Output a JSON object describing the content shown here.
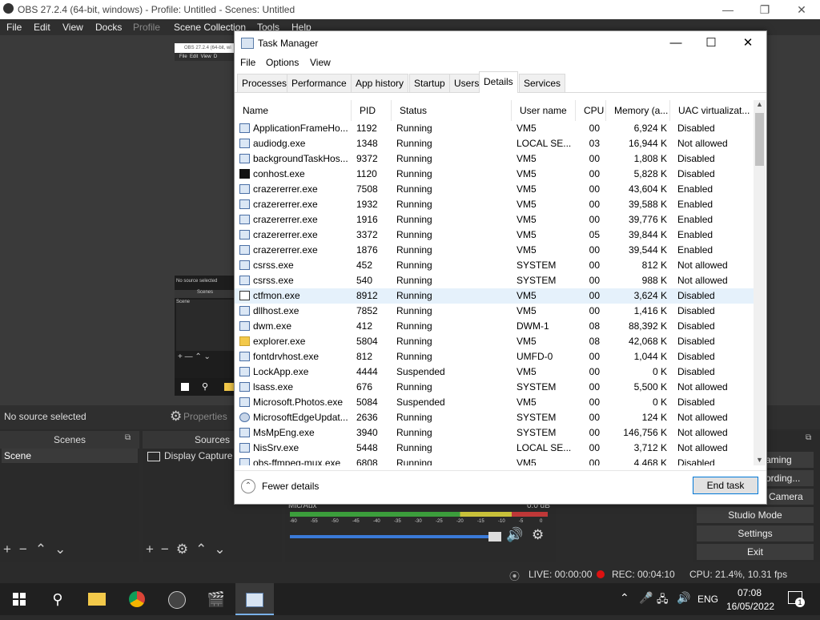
{
  "obs": {
    "title": "OBS 27.2.4 (64-bit, windows) - Profile: Untitled - Scenes: Untitled",
    "menu": [
      "File",
      "Edit",
      "View",
      "Docks",
      "Profile",
      "Scene Collection",
      "Tools",
      "Help"
    ],
    "mini_title": "OBS 27.2.4 (64-bit, wi",
    "mini_menu": "File  Edit  View  D",
    "mini_no_source": "No source selected",
    "mini_scenes": "Scenes",
    "mini_scene": "Scene",
    "no_source": "No source selected",
    "properties": "Properties",
    "scenes_header": "Scenes",
    "scene_item": "Scene",
    "sources_header": "Sources",
    "source_item": "Display Capture",
    "mic_label": "Mic/Aux",
    "mic_db": "0.0 dB",
    "meter_ticks": [
      "-60",
      "-55",
      "-50",
      "-45",
      "-40",
      "-35",
      "-30",
      "-25",
      "-20",
      "-15",
      "-10",
      "-5",
      "0"
    ],
    "controls": [
      "aming",
      "ording...",
      "Camera",
      "Studio Mode",
      "Settings",
      "Exit"
    ],
    "status": {
      "live": "LIVE: 00:00:00",
      "rec": "REC: 00:04:10",
      "cpu": "CPU: 21.4%, 10.31 fps"
    }
  },
  "taskbar": {
    "lang": "ENG",
    "time": "07:08",
    "date": "16/05/2022",
    "notif": "1"
  },
  "tm": {
    "title": "Task Manager",
    "menu": [
      "File",
      "Options",
      "View"
    ],
    "tabs": [
      "Processes",
      "Performance",
      "App history",
      "Startup",
      "Users",
      "Details",
      "Services"
    ],
    "active_tab": "Details",
    "columns": [
      "Name",
      "PID",
      "Status",
      "User name",
      "CPU",
      "Memory (a...",
      "UAC virtualizat..."
    ],
    "rows": [
      {
        "name": "ApplicationFrameHo...",
        "pid": "1192",
        "status": "Running",
        "user": "VM5",
        "cpu": "00",
        "mem": "6,924 K",
        "uac": "Disabled",
        "icon": "app"
      },
      {
        "name": "audiodg.exe",
        "pid": "1348",
        "status": "Running",
        "user": "LOCAL SE...",
        "cpu": "03",
        "mem": "16,944 K",
        "uac": "Not allowed",
        "icon": "app"
      },
      {
        "name": "backgroundTaskHos...",
        "pid": "9372",
        "status": "Running",
        "user": "VM5",
        "cpu": "00",
        "mem": "1,808 K",
        "uac": "Disabled",
        "icon": "app"
      },
      {
        "name": "conhost.exe",
        "pid": "1120",
        "status": "Running",
        "user": "VM5",
        "cpu": "00",
        "mem": "5,828 K",
        "uac": "Disabled",
        "icon": "cmd"
      },
      {
        "name": "crazererrer.exe",
        "pid": "7508",
        "status": "Running",
        "user": "VM5",
        "cpu": "00",
        "mem": "43,604 K",
        "uac": "Enabled",
        "icon": "app"
      },
      {
        "name": "crazererrer.exe",
        "pid": "1932",
        "status": "Running",
        "user": "VM5",
        "cpu": "00",
        "mem": "39,588 K",
        "uac": "Enabled",
        "icon": "app"
      },
      {
        "name": "crazererrer.exe",
        "pid": "1916",
        "status": "Running",
        "user": "VM5",
        "cpu": "00",
        "mem": "39,776 K",
        "uac": "Enabled",
        "icon": "app"
      },
      {
        "name": "crazererrer.exe",
        "pid": "3372",
        "status": "Running",
        "user": "VM5",
        "cpu": "05",
        "mem": "39,844 K",
        "uac": "Enabled",
        "icon": "app"
      },
      {
        "name": "crazererrer.exe",
        "pid": "1876",
        "status": "Running",
        "user": "VM5",
        "cpu": "00",
        "mem": "39,544 K",
        "uac": "Enabled",
        "icon": "app"
      },
      {
        "name": "csrss.exe",
        "pid": "452",
        "status": "Running",
        "user": "SYSTEM",
        "cpu": "00",
        "mem": "812 K",
        "uac": "Not allowed",
        "icon": "app"
      },
      {
        "name": "csrss.exe",
        "pid": "540",
        "status": "Running",
        "user": "SYSTEM",
        "cpu": "00",
        "mem": "988 K",
        "uac": "Not allowed",
        "icon": "app"
      },
      {
        "name": "ctfmon.exe",
        "pid": "8912",
        "status": "Running",
        "user": "VM5",
        "cpu": "00",
        "mem": "3,624 K",
        "uac": "Disabled",
        "icon": "note",
        "selected": true
      },
      {
        "name": "dllhost.exe",
        "pid": "7852",
        "status": "Running",
        "user": "VM5",
        "cpu": "00",
        "mem": "1,416 K",
        "uac": "Disabled",
        "icon": "app"
      },
      {
        "name": "dwm.exe",
        "pid": "412",
        "status": "Running",
        "user": "DWM-1",
        "cpu": "08",
        "mem": "88,392 K",
        "uac": "Disabled",
        "icon": "app"
      },
      {
        "name": "explorer.exe",
        "pid": "5804",
        "status": "Running",
        "user": "VM5",
        "cpu": "08",
        "mem": "42,068 K",
        "uac": "Disabled",
        "icon": "folder"
      },
      {
        "name": "fontdrvhost.exe",
        "pid": "812",
        "status": "Running",
        "user": "UMFD-0",
        "cpu": "00",
        "mem": "1,044 K",
        "uac": "Disabled",
        "icon": "app"
      },
      {
        "name": "LockApp.exe",
        "pid": "4444",
        "status": "Suspended",
        "user": "VM5",
        "cpu": "00",
        "mem": "0 K",
        "uac": "Disabled",
        "icon": "app"
      },
      {
        "name": "lsass.exe",
        "pid": "676",
        "status": "Running",
        "user": "SYSTEM",
        "cpu": "00",
        "mem": "5,500 K",
        "uac": "Not allowed",
        "icon": "app"
      },
      {
        "name": "Microsoft.Photos.exe",
        "pid": "5084",
        "status": "Suspended",
        "user": "VM5",
        "cpu": "00",
        "mem": "0 K",
        "uac": "Disabled",
        "icon": "app"
      },
      {
        "name": "MicrosoftEdgeUpdat...",
        "pid": "2636",
        "status": "Running",
        "user": "SYSTEM",
        "cpu": "00",
        "mem": "124 K",
        "uac": "Not allowed",
        "icon": "gear"
      },
      {
        "name": "MsMpEng.exe",
        "pid": "3940",
        "status": "Running",
        "user": "SYSTEM",
        "cpu": "00",
        "mem": "146,756 K",
        "uac": "Not allowed",
        "icon": "app"
      },
      {
        "name": "NisSrv.exe",
        "pid": "5448",
        "status": "Running",
        "user": "LOCAL SE...",
        "cpu": "00",
        "mem": "3,712 K",
        "uac": "Not allowed",
        "icon": "app"
      },
      {
        "name": "obs-ffmpeg-mux.exe",
        "pid": "6808",
        "status": "Running",
        "user": "VM5",
        "cpu": "00",
        "mem": "4,468 K",
        "uac": "Disabled",
        "icon": "app"
      }
    ],
    "fewer_details": "Fewer details",
    "end_task": "End task"
  }
}
